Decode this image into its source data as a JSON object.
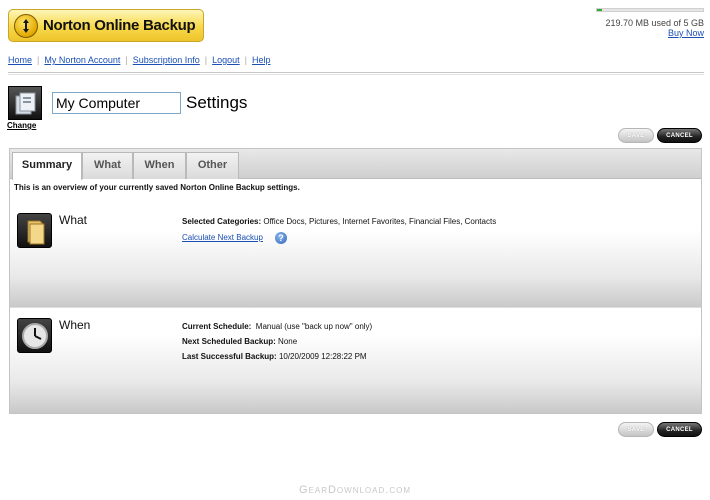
{
  "app": {
    "logo_text": "Norton Online Backup"
  },
  "storage": {
    "used_text": "219.70 MB used of 5 GB",
    "used_fraction": 0.044,
    "buy_now": "Buy Now"
  },
  "nav": {
    "items": [
      "Home",
      "My Norton Account",
      "Subscription Info",
      "Logout",
      "Help"
    ]
  },
  "computer": {
    "name_value": "My Computer",
    "change_label": "Change",
    "settings_title": "Settings"
  },
  "buttons": {
    "save": "SAVE",
    "cancel": "CANCEL"
  },
  "tabs": [
    "Summary",
    "What",
    "When",
    "Other"
  ],
  "summary": {
    "overview": "This is an overview of your currently saved Norton Online Backup settings.",
    "what": {
      "title": "What",
      "categories_label": "Selected Categories:",
      "categories_value": "Office Docs, Pictures, Internet Favorites, Financial Files, Contacts",
      "calc_link": "Calculate Next Backup",
      "help_glyph": "?"
    },
    "when": {
      "title": "When",
      "schedule_label": "Current Schedule:",
      "schedule_value": "Manual (use \"back up now\" only)",
      "next_label": "Next Scheduled Backup:",
      "next_value": "None",
      "last_label": "Last Successful Backup:",
      "last_value": "10/20/2009 12:28:22 PM"
    }
  },
  "watermark": "GearDownload.com",
  "icons": {
    "logo": "norton-check-badge-icon",
    "computer": "computer-icon",
    "what": "folder-icon",
    "when": "clock-icon",
    "help": "help-icon"
  }
}
